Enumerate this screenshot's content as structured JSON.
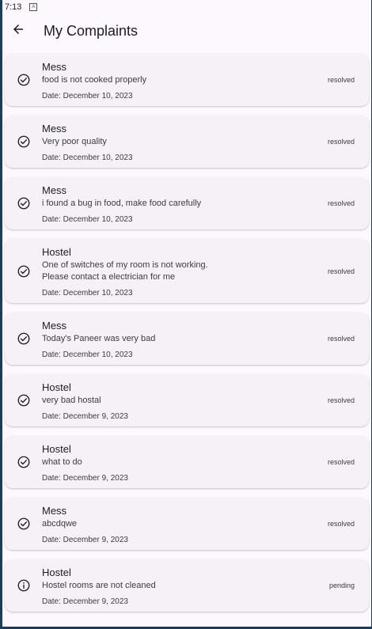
{
  "statusbar": {
    "time": "7:13",
    "notification_icon": "A"
  },
  "appbar": {
    "title": "My Complaints",
    "back_icon": "arrow-left-icon"
  },
  "complaints": [
    {
      "category": "Mess",
      "description": "food is not cooked properly",
      "date": "Date: December 10, 2023",
      "status": "resolved",
      "icon": "check-circle-icon"
    },
    {
      "category": "Mess",
      "description": "Very poor quality",
      "date": "Date: December 10, 2023",
      "status": "resolved",
      "icon": "check-circle-icon"
    },
    {
      "category": "Mess",
      "description": "i found a bug in food, make food carefully",
      "date": "Date: December 10, 2023",
      "status": "resolved",
      "icon": "check-circle-icon"
    },
    {
      "category": "Hostel",
      "description": "One of switches of my room is not working.\nPlease contact a electrician for me",
      "date": "Date: December 10, 2023",
      "status": "resolved",
      "icon": "check-circle-icon"
    },
    {
      "category": "Mess",
      "description": "Today's Paneer was very bad",
      "date": "Date: December 10, 2023",
      "status": "resolved",
      "icon": "check-circle-icon"
    },
    {
      "category": "Hostel",
      "description": "very bad hostal",
      "date": "Date: December 9, 2023",
      "status": "resolved",
      "icon": "check-circle-icon"
    },
    {
      "category": "Hostel",
      "description": "what to do",
      "date": "Date: December 9, 2023",
      "status": "resolved",
      "icon": "check-circle-icon"
    },
    {
      "category": "Mess",
      "description": "abcdqwe",
      "date": "Date: December 9, 2023",
      "status": "resolved",
      "icon": "check-circle-icon"
    },
    {
      "category": "Hostel",
      "description": "Hostel rooms are not cleaned",
      "date": "Date: December 9, 2023",
      "status": "pending",
      "icon": "info-icon"
    }
  ]
}
